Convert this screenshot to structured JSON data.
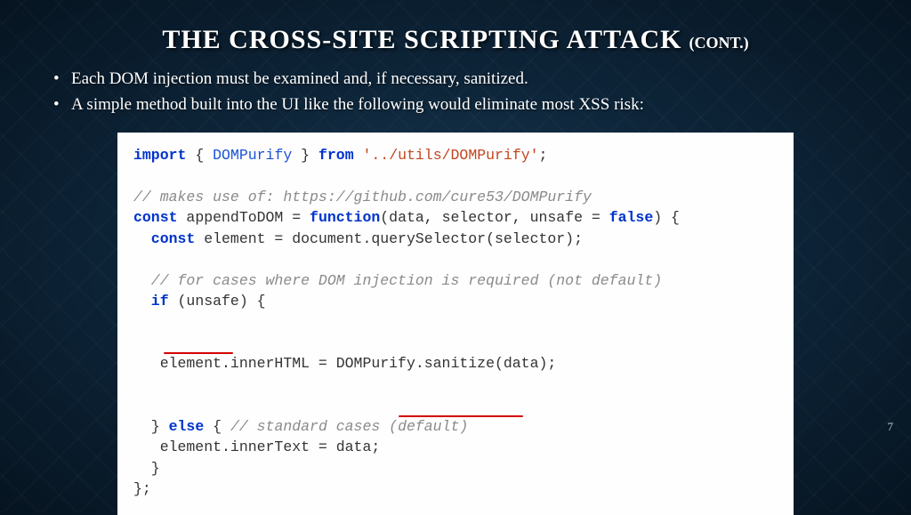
{
  "title": "THE CROSS-SITE SCRIPTING ATTACK",
  "subtitle": "(CONT.)",
  "bullets": [
    "Each DOM injection must be examined and, if necessary, sanitized.",
    "A simple method built into the UI like the following would eliminate most XSS risk:"
  ],
  "code": {
    "l1_import": "import",
    "l1_lb": " { ",
    "l1_dp": "DOMPurify",
    "l1_rb": " } ",
    "l1_from": "from",
    "l1_sp": " ",
    "l1_str": "'../utils/DOMPurify'",
    "l1_end": ";",
    "l3_com": "// makes use of: https://github.com/cure53/DOMPurify",
    "l4_const": "const",
    "l4_a": " appendToDOM = ",
    "l4_func": "function",
    "l4_b": "(data, selector, unsafe = ",
    "l4_false": "false",
    "l4_c": ") {",
    "l5_const": "  const",
    "l5_a": " element = document.querySelector(selector);",
    "l7_com": "  // for cases where DOM injection is required (not default)",
    "l8_if": "  if",
    "l8_a": " (unsafe) {",
    "l9_a": "   element.innerHTML = DOMPurify.sanitize(data);",
    "l10_a": "  } ",
    "l10_else": "else",
    "l10_b": " { ",
    "l10_com": "// standard cases (default)",
    "l11_a": "   element.innerText = data;",
    "l12_a": "  }",
    "l13_a": "};"
  },
  "pageNumber": "7"
}
